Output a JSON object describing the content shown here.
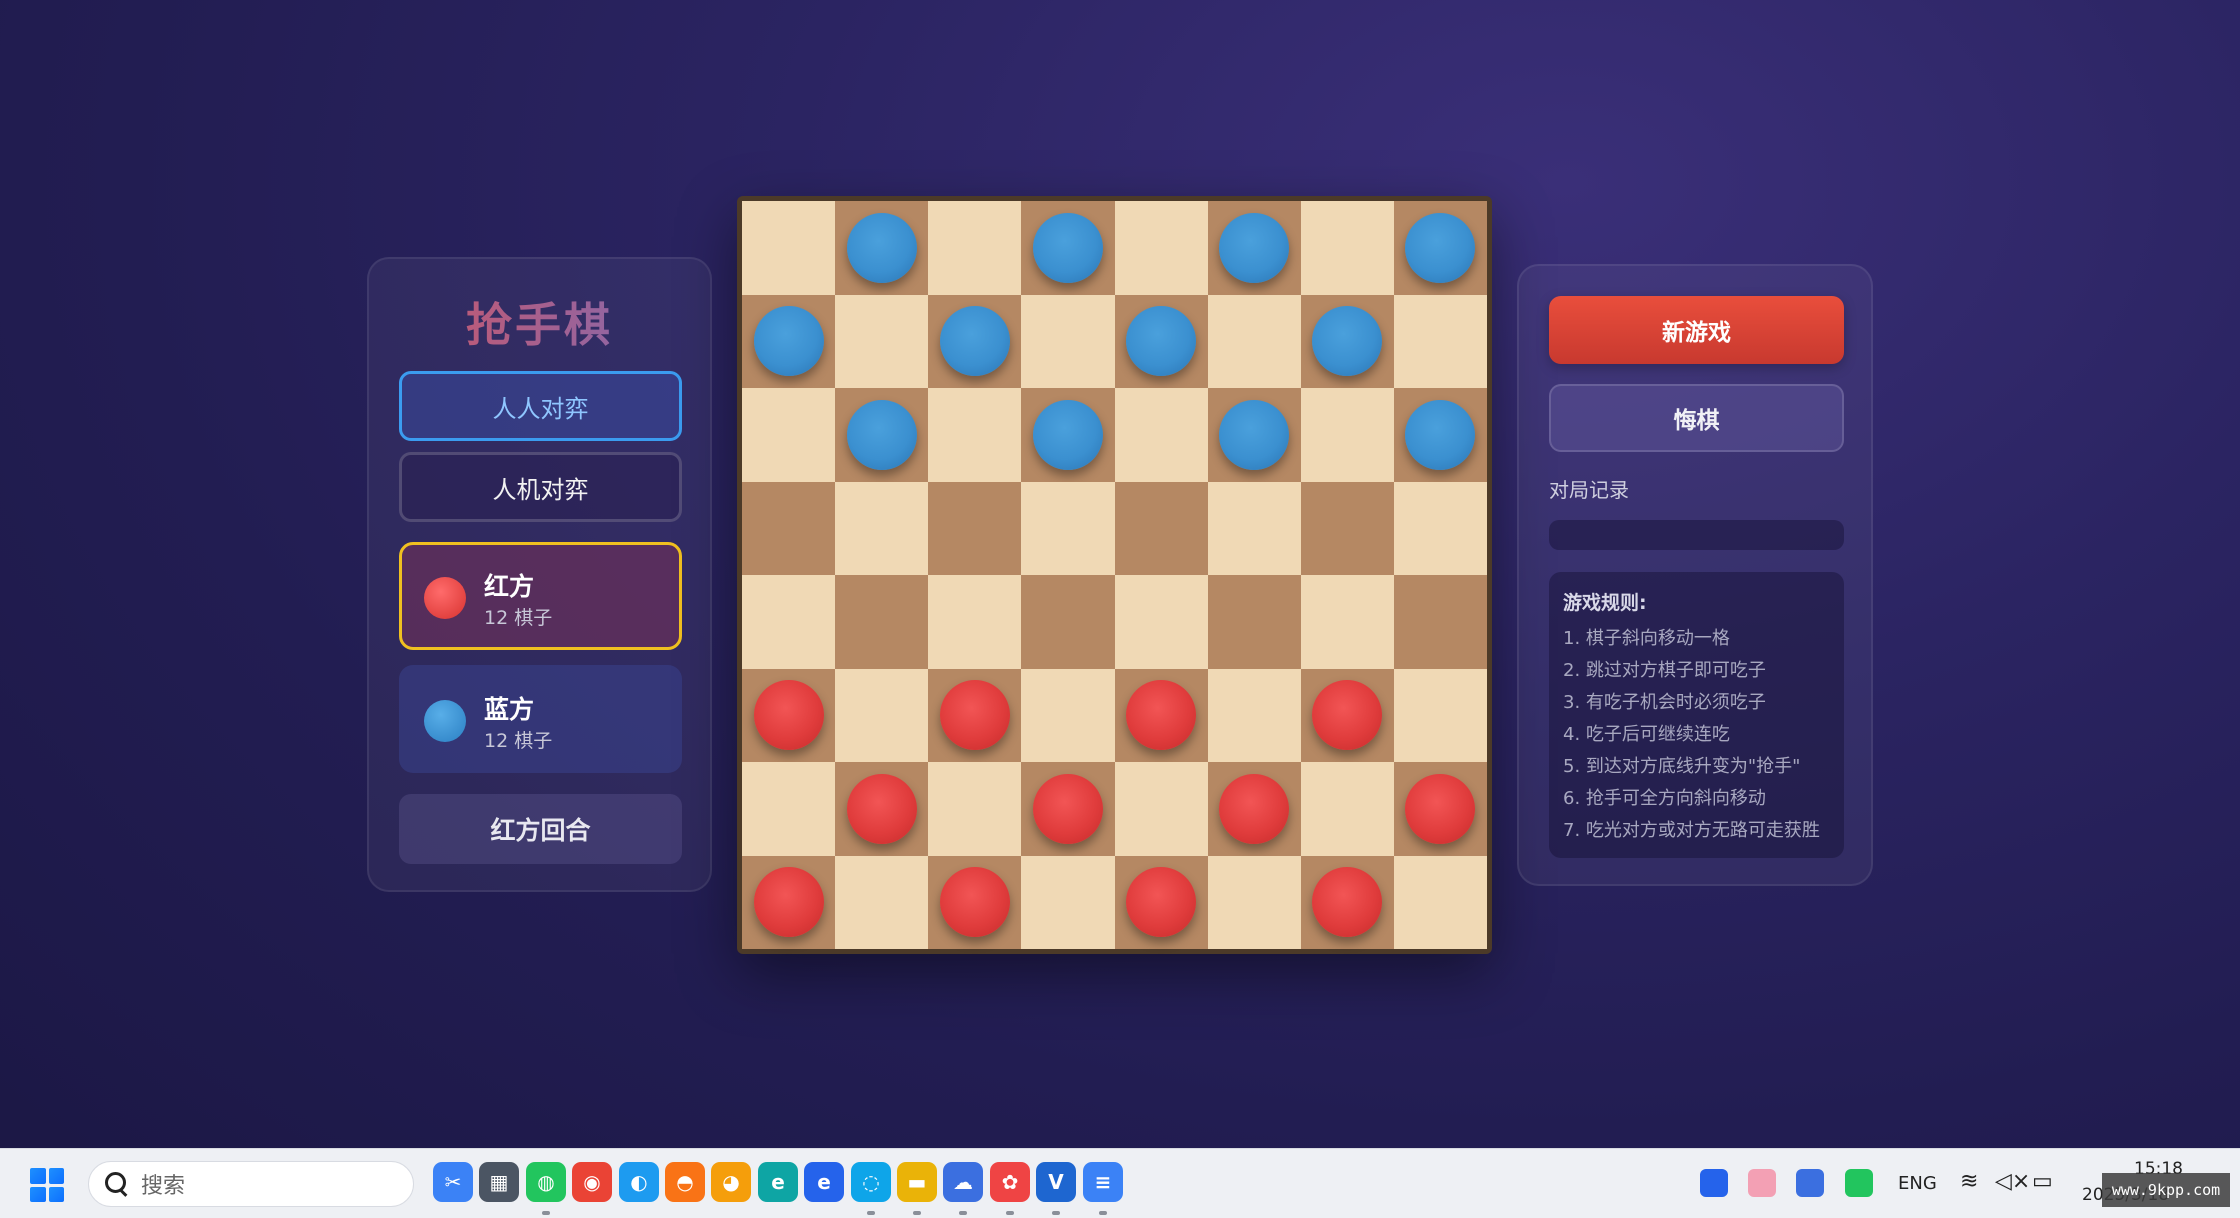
{
  "left_panel": {
    "title": "抢手棋",
    "modes": [
      {
        "label": "人人对弈",
        "active": true
      },
      {
        "label": "人机对弈",
        "active": false
      }
    ],
    "players": [
      {
        "name": "红方",
        "count": "12 棋子",
        "color": "#e03c3c",
        "active": true
      },
      {
        "name": "蓝方",
        "count": "12 棋子",
        "color": "#3b90d0",
        "active": false
      }
    ],
    "turn": "红方回合"
  },
  "board": {
    "size": 8,
    "rows": [
      ".b.b.b.b",
      "b.b.b.b.",
      ".b.b.b.b",
      "........",
      "........",
      "r.r.r.r.",
      ".r.r.r.r",
      "r.r.r.r."
    ],
    "dark_cell_color": "#b58863",
    "light_cell_color": "#f0d9b5",
    "red_piece_color": "#e03c3c",
    "blue_piece_color": "#3b90d0"
  },
  "right_panel": {
    "new_game_label": "新游戏",
    "undo_label": "悔棋",
    "history_label": "对局记录",
    "rules_title": "游戏规则:",
    "rules": [
      "1. 棋子斜向移动一格",
      "2. 跳过对方棋子即可吃子",
      "3. 有吃子机会时必须吃子",
      "4. 吃子后可继续连吃",
      "5. 到达对方底线升变为\"抢手\"",
      "6. 抢手可全方向斜向移动",
      "7. 吃光对方或对方无路可走获胜"
    ]
  },
  "taskbar": {
    "search_placeholder": "搜索",
    "apps": [
      {
        "icon": "snipping-tool-icon",
        "color": "#3b82f6"
      },
      {
        "icon": "calculator-icon",
        "color": "#4b5563"
      },
      {
        "icon": "wechat-icon",
        "color": "#22c55e"
      },
      {
        "icon": "chrome-icon",
        "color": "#ea4335"
      },
      {
        "icon": "browser-icon",
        "color": "#1d9bf0"
      },
      {
        "icon": "app-orange-icon",
        "color": "#f97316"
      },
      {
        "icon": "firefox-icon",
        "color": "#f59e0b"
      },
      {
        "icon": "edge-icon",
        "color": "#0ea5a4"
      },
      {
        "icon": "ie-icon",
        "color": "#2563eb"
      },
      {
        "icon": "chat-icon",
        "color": "#0ea5e9"
      },
      {
        "icon": "file-explorer-icon",
        "color": "#eab308"
      },
      {
        "icon": "cloud-drive-icon",
        "color": "#3b6fe0"
      },
      {
        "icon": "photos-icon",
        "color": "#ef4444"
      },
      {
        "icon": "vscode-icon",
        "color": "#1e66d0"
      },
      {
        "icon": "notepad-icon",
        "color": "#3b82f6"
      }
    ],
    "language": "ENG",
    "time": "15:18",
    "date": "2025/3/18",
    "watermark": "www.9kpp.com"
  }
}
